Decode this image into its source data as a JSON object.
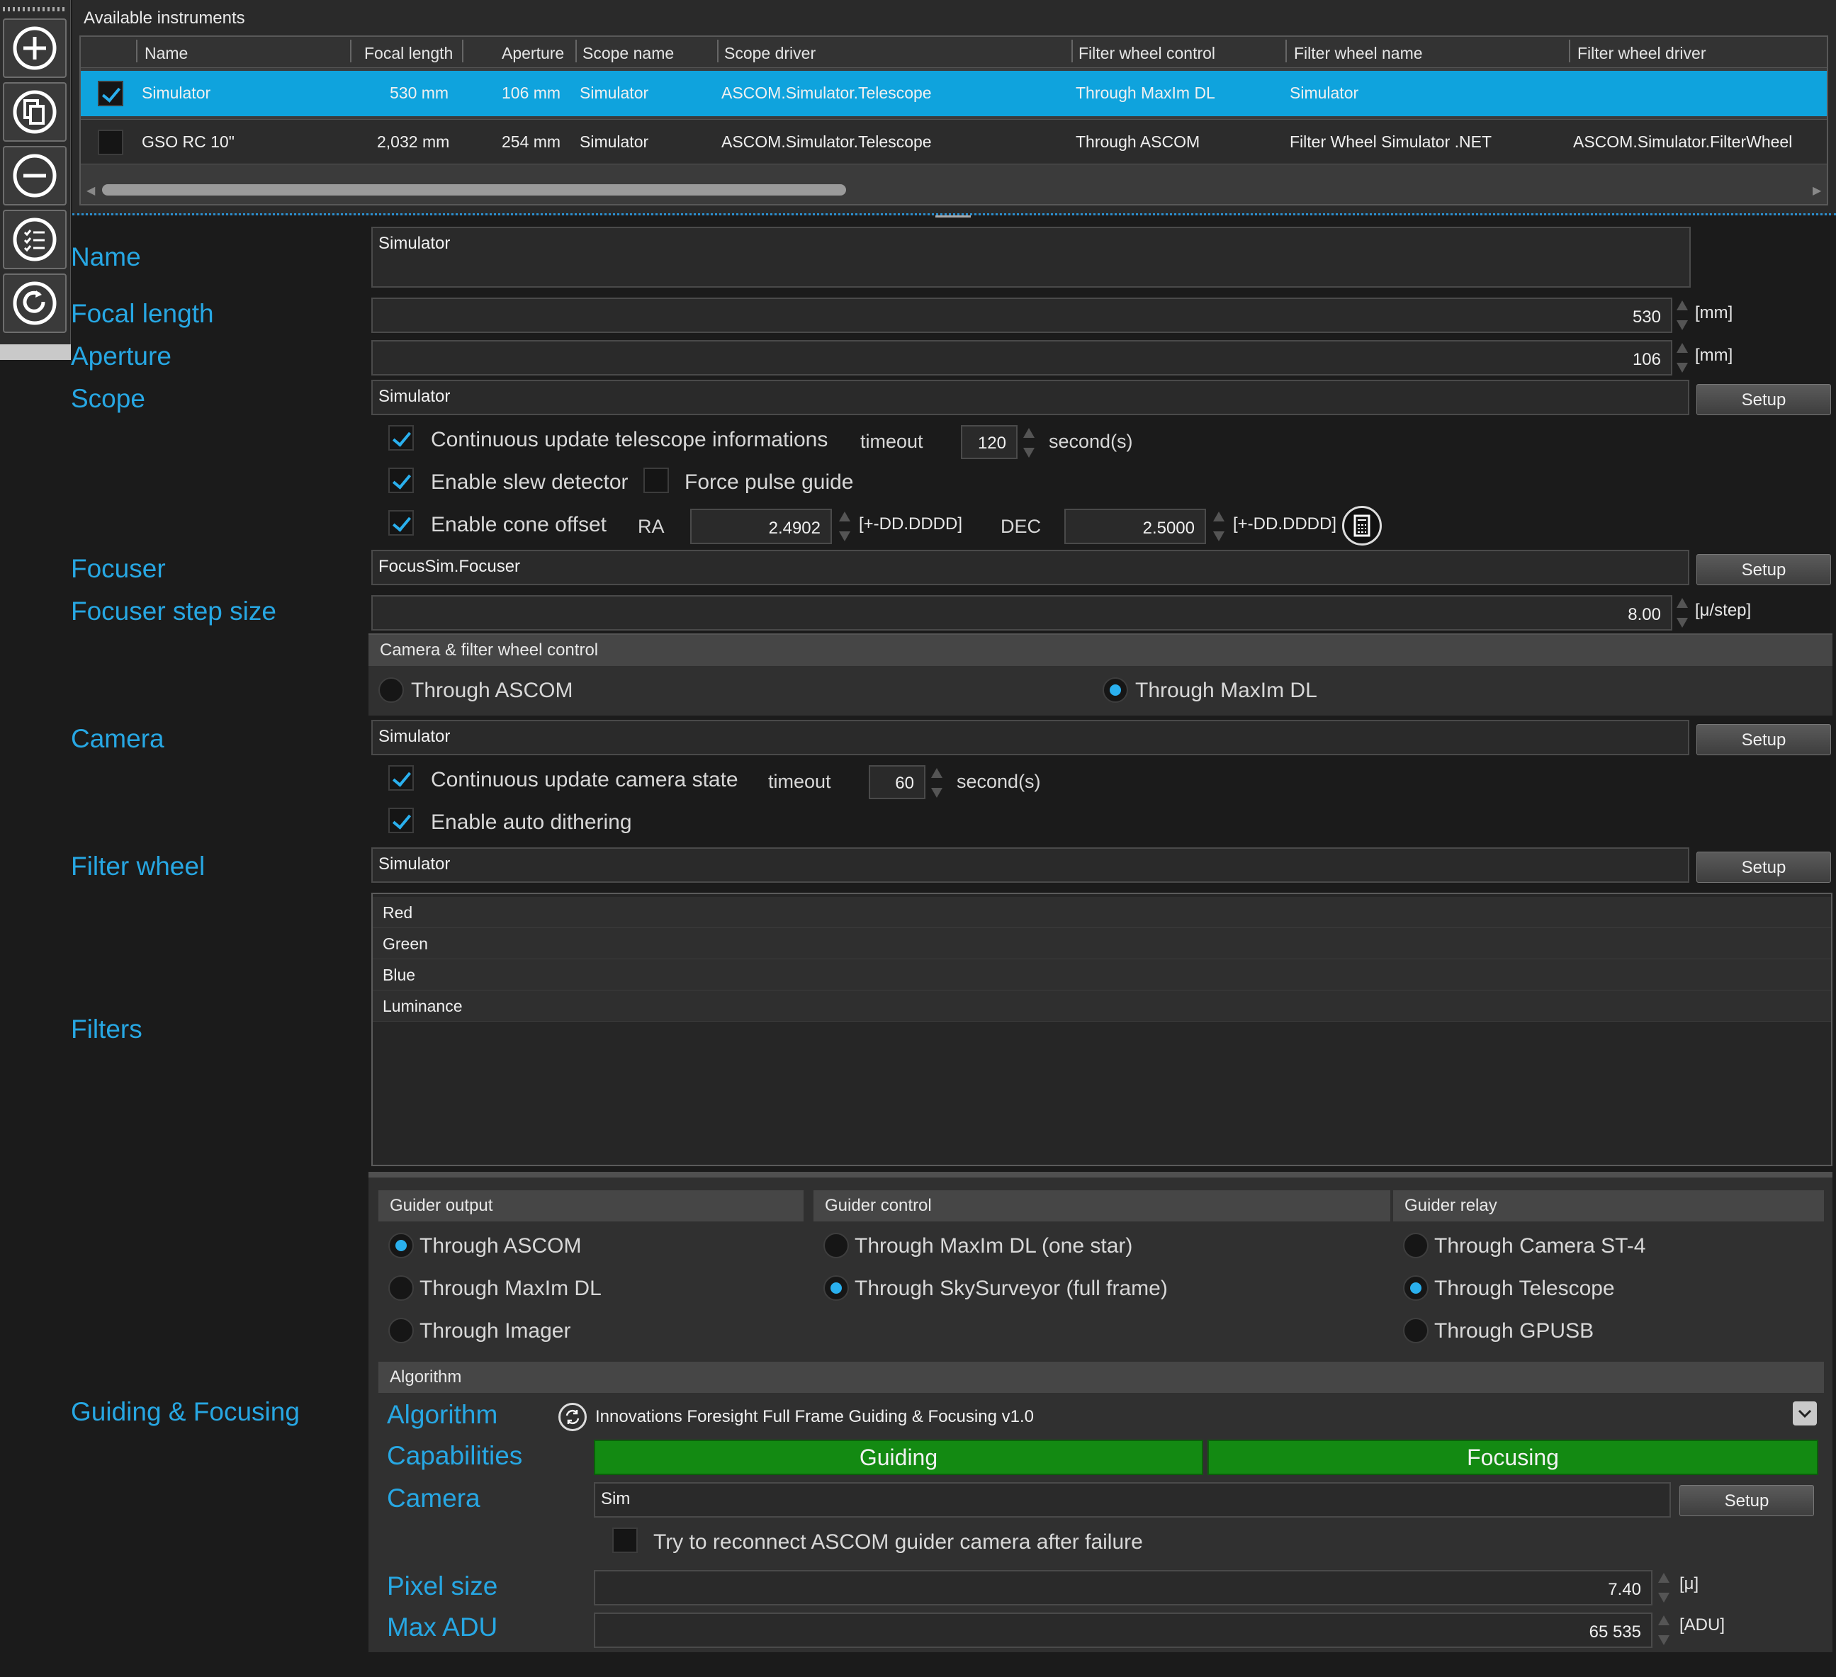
{
  "toolbar": {
    "icons": [
      "add-icon",
      "copy-icon",
      "remove-icon",
      "checklist-icon",
      "refresh-icon"
    ]
  },
  "instruments": {
    "title": "Available instruments",
    "columns": [
      "Name",
      "Focal length",
      "Aperture",
      "Scope name",
      "Scope driver",
      "Filter wheel control",
      "Filter wheel name",
      "Filter wheel driver"
    ],
    "rows": [
      {
        "checked": true,
        "name": "Simulator",
        "focal": "530 mm",
        "aperture": "106 mm",
        "scope_name": "Simulator",
        "scope_driver": "ASCOM.Simulator.Telescope",
        "fw_control": "Through MaxIm DL",
        "fw_name": "Simulator",
        "fw_driver": ""
      },
      {
        "checked": false,
        "name": "GSO RC 10\"",
        "focal": "2,032 mm",
        "aperture": "254 mm",
        "scope_name": "Simulator",
        "scope_driver": "ASCOM.Simulator.Telescope",
        "fw_control": "Through ASCOM",
        "fw_name": "Filter Wheel Simulator .NET",
        "fw_driver": "ASCOM.Simulator.FilterWheel"
      }
    ]
  },
  "labels": {
    "name": "Name",
    "focal_length": "Focal length",
    "aperture": "Aperture",
    "scope": "Scope",
    "focuser": "Focuser",
    "focuser_step": "Focuser step size",
    "camera": "Camera",
    "filter_wheel": "Filter wheel",
    "filters": "Filters",
    "guiding": "Guiding & Focusing"
  },
  "form": {
    "name": "Simulator",
    "focal_length": "530",
    "focal_unit": "[mm]",
    "aperture": "106",
    "aperture_unit": "[mm]",
    "scope": "Simulator",
    "setup": "Setup",
    "continuous_scope": "Continuous update telescope informations",
    "timeout_label": "timeout",
    "scope_timeout": "120",
    "seconds": "second(s)",
    "slew_detector": "Enable slew detector",
    "force_pulse": "Force pulse guide",
    "cone_offset": "Enable cone offset",
    "ra_label": "RA",
    "ra_value": "2.4902",
    "deg_unit": "[+-DD.DDDD]",
    "dec_label": "DEC",
    "dec_value": "2.5000",
    "focuser": "FocusSim.Focuser",
    "focuser_step": "8.00",
    "step_unit": "[μ/step]",
    "cfw_title": "Camera & filter wheel control",
    "cfw_opt1": "Through ASCOM",
    "cfw_opt2": "Through MaxIm DL",
    "camera": "Simulator",
    "continuous_camera": "Continuous update camera state",
    "camera_timeout": "60",
    "auto_dither": "Enable auto dithering",
    "filter_wheel": "Simulator",
    "filters": [
      "Red",
      "Green",
      "Blue",
      "Luminance"
    ]
  },
  "guider": {
    "output_title": "Guider output",
    "output_opts": [
      "Through ASCOM",
      "Through MaxIm DL",
      "Through Imager"
    ],
    "control_title": "Guider control",
    "control_opts": [
      "Through MaxIm DL (one star)",
      "Through SkySurveyor (full frame)"
    ],
    "relay_title": "Guider relay",
    "relay_opts": [
      "Through Camera ST-4",
      "Through Telescope",
      "Through GPUSB"
    ],
    "algorithm_title": "Algorithm",
    "algorithm_label": "Algorithm",
    "algorithm_value": "Innovations Foresight Full Frame Guiding & Focusing v1.0",
    "capabilities_label": "Capabilities",
    "cap_guiding": "Guiding",
    "cap_focusing": "Focusing",
    "camera_label": "Camera",
    "camera_value": "Sim",
    "reconnect": "Try to reconnect ASCOM guider camera after failure",
    "pixel_label": "Pixel size",
    "pixel_value": "7.40",
    "pixel_unit": "[μ]",
    "maxadu_label": "Max ADU",
    "maxadu_value": "65 535",
    "adu_unit": "[ADU]"
  },
  "colors": {
    "accent": "#27a7e3",
    "selection": "#0fa3dd",
    "capability": "#138a12"
  }
}
